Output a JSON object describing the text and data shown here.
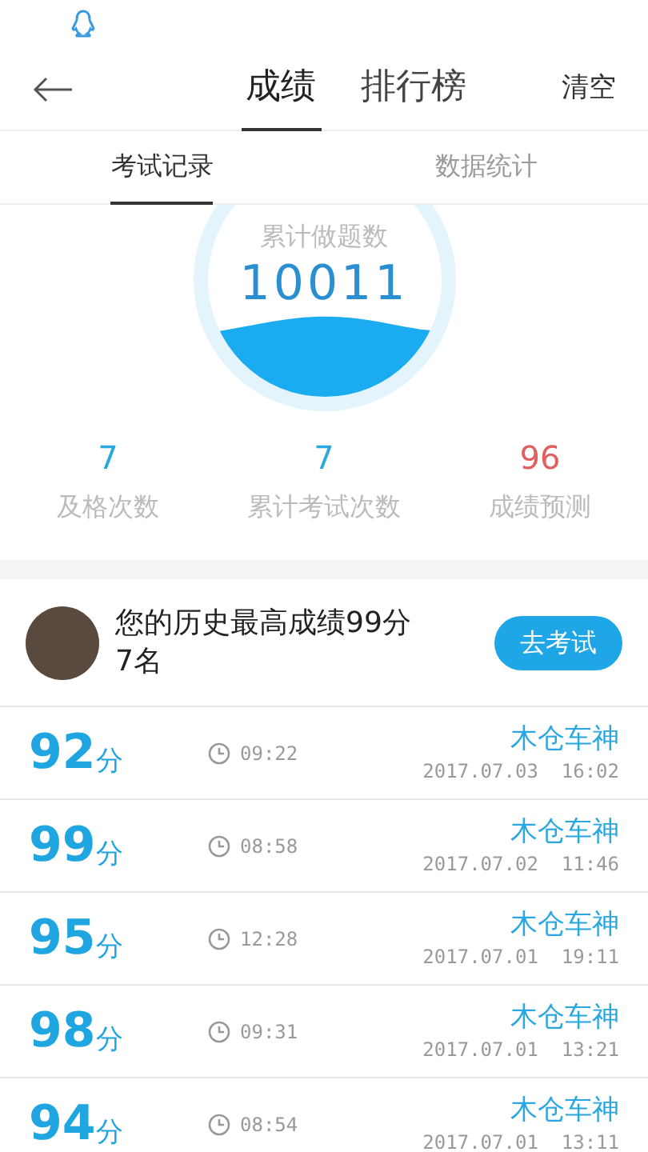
{
  "header": {
    "tabs": [
      {
        "label": "成绩",
        "selected": true
      },
      {
        "label": "排行榜",
        "selected": false
      }
    ],
    "action": "清空"
  },
  "sub_tabs": [
    {
      "label": "考试记录",
      "selected": true
    },
    {
      "label": "数据统计",
      "selected": false
    }
  ],
  "total": {
    "label": "累计做题数",
    "value": "10011"
  },
  "stats": [
    {
      "value": "7",
      "label": "及格次数",
      "color": "#29a8e0"
    },
    {
      "value": "7",
      "label": "累计考试次数",
      "color": "#29a8e0"
    },
    {
      "value": "96",
      "label": "成绩预测",
      "color": "#e06060"
    }
  ],
  "profile": {
    "best": "您的历史最高成绩99分",
    "rank": "7名",
    "button": "去考试"
  },
  "records": [
    {
      "score": "92",
      "unit": "分",
      "duration": "09:22",
      "title": "木仓车神",
      "datetime": "2017.07.03  16:02"
    },
    {
      "score": "99",
      "unit": "分",
      "duration": "08:58",
      "title": "木仓车神",
      "datetime": "2017.07.02  11:46"
    },
    {
      "score": "95",
      "unit": "分",
      "duration": "12:28",
      "title": "木仓车神",
      "datetime": "2017.07.01  19:11"
    },
    {
      "score": "98",
      "unit": "分",
      "duration": "09:31",
      "title": "木仓车神",
      "datetime": "2017.07.01  13:21"
    },
    {
      "score": "94",
      "unit": "分",
      "duration": "08:54",
      "title": "木仓车神",
      "datetime": "2017.07.01  13:11"
    }
  ]
}
